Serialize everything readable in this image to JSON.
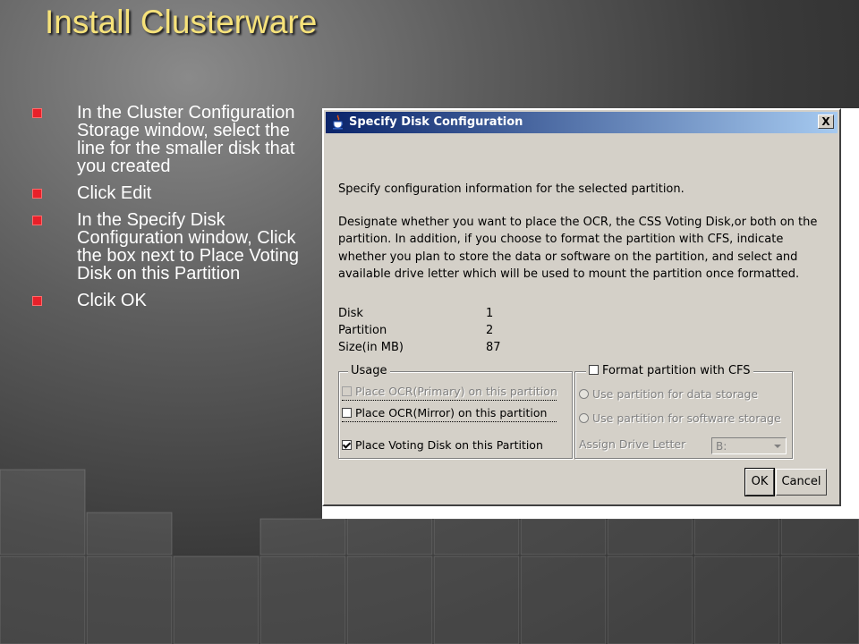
{
  "slide": {
    "title": "Install Clusterware",
    "bullets": [
      "In the Cluster Configuration Storage window, select the line for the smaller disk that you created",
      "Click Edit",
      "In the Specify Disk Configuration window, Click the box next to Place Voting Disk on this Partition",
      "Clcik OK"
    ]
  },
  "dialog": {
    "title": "Specify Disk Configuration",
    "close_label": "X",
    "intro": "Specify configuration information for the selected partition.",
    "description": "Designate whether you want to place the OCR, the CSS Voting Disk,or both on the partition. In addition, if you choose to format the partition with CFS, indicate whether you plan to store the data or software on the partition, and select and available drive letter which will be used to mount the partition once formatted.",
    "info": {
      "disk_label": "Disk",
      "disk_value": "1",
      "partition_label": "Partition",
      "partition_value": "2",
      "size_label": "Size(in MB)",
      "size_value": "87"
    },
    "usage": {
      "legend": "Usage",
      "ocr_primary": "Place OCR(Primary) on this partition",
      "ocr_mirror": "Place OCR(Mirror) on this partition",
      "voting_disk": "Place Voting Disk on this Partition",
      "ocr_primary_checked": false,
      "ocr_mirror_checked": false,
      "voting_disk_checked": true
    },
    "format": {
      "legend": "Format partition with CFS",
      "format_checked": false,
      "data_storage": "Use partition for data storage",
      "software_storage": "Use partition for software storage",
      "drive_letter_label": "Assign Drive Letter",
      "drive_letter_value": "B:"
    },
    "buttons": {
      "ok": "OK",
      "cancel": "Cancel"
    }
  },
  "colors": {
    "title": "#f6e27a",
    "bullet": "#e8202a",
    "titlebar_start": "#0a246a",
    "titlebar_end": "#a6caf0",
    "dialog_bg": "#d4d0c8"
  }
}
